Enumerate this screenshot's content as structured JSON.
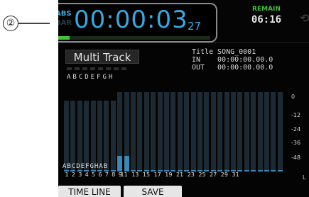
{
  "callout": {
    "number": "②"
  },
  "counter": {
    "mode_abs": "ABS",
    "mode_bar": "BAR",
    "time": "00:00:03",
    "frames": "27",
    "progress_percent": 9
  },
  "remain": {
    "label": "REMAIN",
    "value": "06:16"
  },
  "icons": {
    "sync": "loop-icon"
  },
  "mode_panel": {
    "label": "Multi Track"
  },
  "track_letters": "ABCDEFGH",
  "info": {
    "title_label": "Title",
    "title_value": "SONG_0001",
    "in_label": "IN",
    "in_value": "00:00:00.00.0",
    "out_label": "OUT",
    "out_value": "00:00:00.00.0"
  },
  "meters": {
    "scale": [
      "0",
      "-12",
      "-24",
      "-36",
      "-48"
    ],
    "left_label": "L",
    "letters_line": "ABCDEFGHAB",
    "track_numbers": [
      "1",
      "2",
      "3",
      "4",
      "5",
      "6",
      "7",
      "8",
      "9",
      "11",
      "13",
      "15",
      "17",
      "19",
      "21",
      "23",
      "25",
      "27",
      "29",
      "31"
    ],
    "levels": [
      0.02,
      0.02,
      0.02,
      0.02,
      0.02,
      0.02,
      0.02,
      0.02,
      0.2,
      0.2,
      0.02,
      0.02,
      0.02,
      0.02,
      0.02,
      0.02,
      0.02,
      0.02,
      0.02,
      0.02,
      0.02,
      0.02,
      0.02,
      0.02,
      0.02,
      0.02,
      0.02,
      0.02,
      0.02,
      0.02,
      0.02,
      0.02,
      0.02
    ]
  },
  "softkeys": {
    "key1": "TIME LINE",
    "key2": "SAVE"
  },
  "colors": {
    "accent": "#39a7de",
    "remain": "#3fbf3f",
    "progress": "#45c040"
  }
}
